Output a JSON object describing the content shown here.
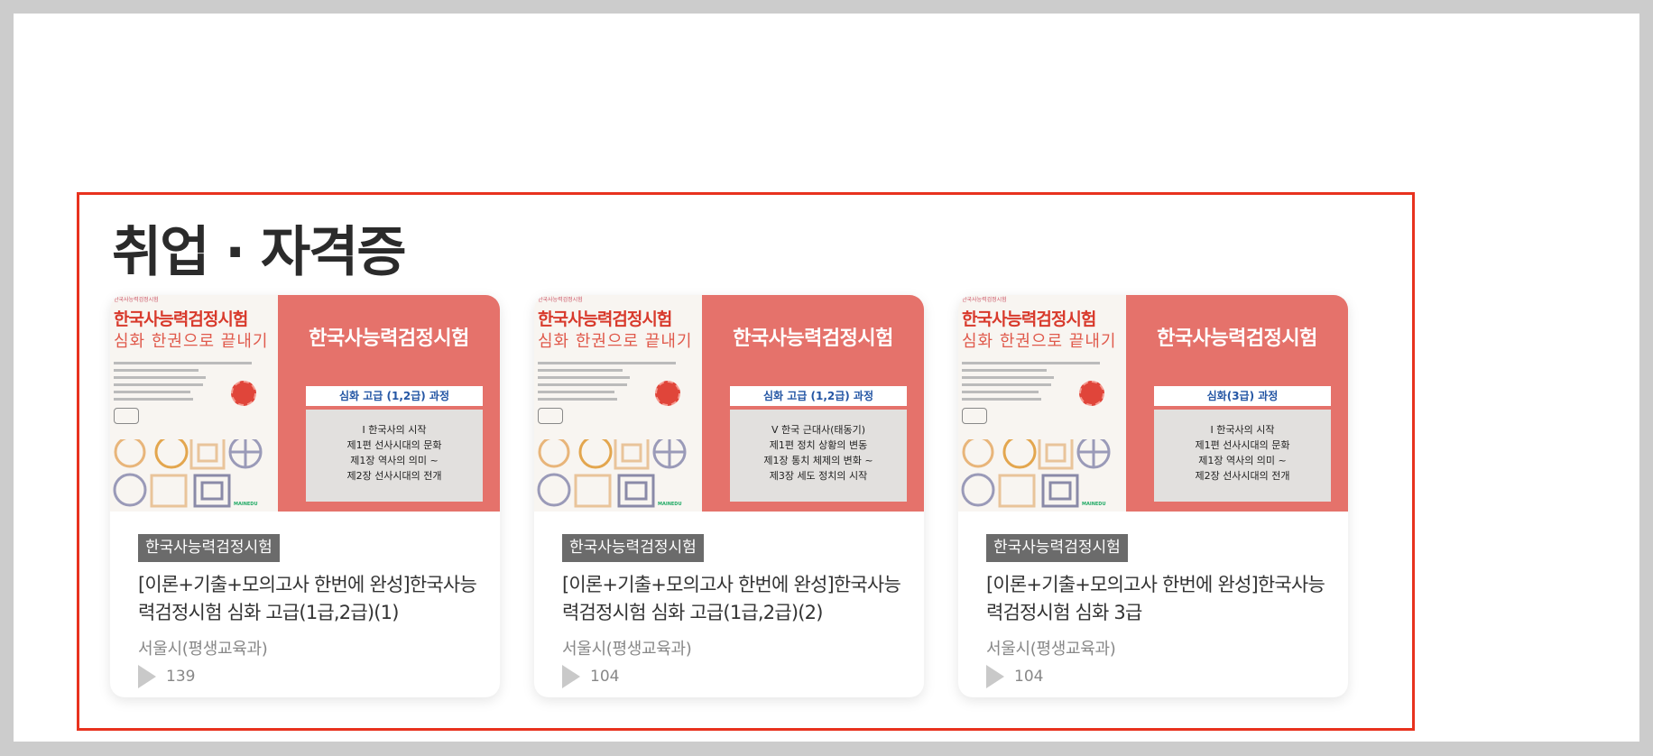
{
  "section": {
    "title": "취업 · 자격증"
  },
  "cards": [
    {
      "cover": {
        "top_small": "한국사능력검정시험",
        "title": "한국사능력검정시험",
        "subtitle": "심화 한권으로 끝내기",
        "right_title": "한국사능력검정시험",
        "course": "심화 고급 (1,2급) 과정",
        "toc": [
          "Ⅰ 한국사의 시작",
          "제1편 선사시대의 문화",
          "제1장 역사의 의미 ~",
          "제2장 선사시대의 전개"
        ],
        "logo": "MAINEDU"
      },
      "tag": "한국사능력검정시험",
      "title": "[이론+기출+모의고사 한번에 완성]한국사능력검정시험 심화 고급(1급,2급)(1)",
      "org": "서울시(평생교육과)",
      "views": "139"
    },
    {
      "cover": {
        "top_small": "한국사능력검정시험",
        "title": "한국사능력검정시험",
        "subtitle": "심화 한권으로 끝내기",
        "right_title": "한국사능력검정시험",
        "course": "심화 고급 (1,2급) 과정",
        "toc": [
          "Ⅴ 한국 근대사(태동기)",
          "제1편 정치 상황의 변동",
          "제1장 통치 체제의 변화 ~",
          "제3장 세도 정치의 시작"
        ],
        "logo": "MAINEDU"
      },
      "tag": "한국사능력검정시험",
      "title": "[이론+기출+모의고사 한번에 완성]한국사능력검정시험 심화 고급(1급,2급)(2)",
      "org": "서울시(평생교육과)",
      "views": "104"
    },
    {
      "cover": {
        "top_small": "한국사능력검정시험",
        "title": "한국사능력검정시험",
        "subtitle": "심화 한권으로 끝내기",
        "right_title": "한국사능력검정시험",
        "course": "심화(3급) 과정",
        "toc": [
          "Ⅰ 한국사의 시작",
          "제1편 선사시대의 문화",
          "제1장 역사의 의미 ~",
          "제2장 선사시대의 전개"
        ],
        "logo": "MAINEDU"
      },
      "tag": "한국사능력검정시험",
      "title": "[이론+기출+모의고사 한번에 완성]한국사능력검정시험 심화 3급",
      "org": "서울시(평생교육과)",
      "views": "104"
    }
  ],
  "colors": {
    "highlight_border": "#e8321e",
    "cover_red": "#e5726b",
    "tag_bg": "#6b6b6b"
  }
}
